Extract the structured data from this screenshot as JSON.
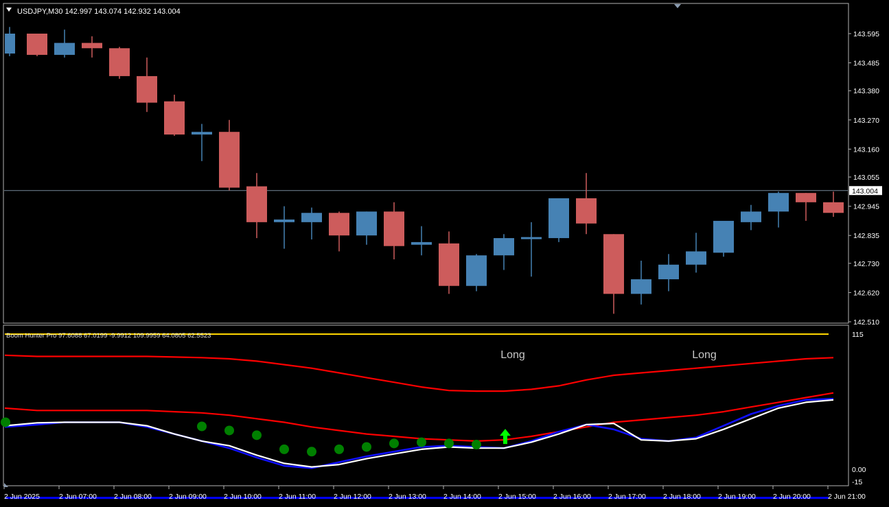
{
  "window": {
    "symbol_header": "USDJPY,M30  142.997 143.074 142.932 143.004",
    "collapse_icon": "triangle-down-icon",
    "scroll_marker_icon": "triangle-down-icon"
  },
  "colors": {
    "background": "#000000",
    "frame": "#b4b4b4",
    "bull": "#4682b4",
    "bear": "#cd5c5c",
    "price_line": "#778899",
    "axis_text": "#ffffff",
    "level_115": "#ffd700",
    "level_0": "#0000ff",
    "red_bands": "#ff0000",
    "blue_line": "#1010ff",
    "white_line": "#ffffff",
    "dots": "#008000",
    "signal_arrow": "#00ff00",
    "long_text": "#c8c8c8"
  },
  "current_price": {
    "value": 143.004,
    "label": "143.004"
  },
  "price_axis_labels": [
    "143.595",
    "143.485",
    "143.380",
    "143.270",
    "143.160",
    "143.055",
    "142.945",
    "142.835",
    "142.730",
    "142.620",
    "142.510"
  ],
  "indicator": {
    "name_label": "Boom Hunter Pro 97.6088 67.0199 -9.9912 109.9959 64.0805 62.5523",
    "axis_labels": {
      "top": "115",
      "zero": "0.00",
      "neg": "-15"
    },
    "signals": [
      {
        "index": 18,
        "text": "Long"
      },
      {
        "index": 25,
        "text": "Long"
      }
    ],
    "arrow_index": 18
  },
  "time_axis": [
    "2 Jun 2025",
    "2 Jun 07:00",
    "2 Jun 08:00",
    "2 Jun 09:00",
    "2 Jun 10:00",
    "2 Jun 11:00",
    "2 Jun 12:00",
    "2 Jun 13:00",
    "2 Jun 14:00",
    "2 Jun 15:00",
    "2 Jun 16:00",
    "2 Jun 17:00",
    "2 Jun 18:00",
    "2 Jun 19:00",
    "2 Jun 20:00",
    "2 Jun 21:00"
  ],
  "chart_data": {
    "type": "candlestick",
    "ylim": [
      142.49,
      143.68
    ],
    "candles": [
      {
        "o": 143.52,
        "h": 143.62,
        "l": 143.51,
        "c": 143.595
      },
      {
        "o": 143.595,
        "h": 143.595,
        "l": 143.51,
        "c": 143.515
      },
      {
        "o": 143.515,
        "h": 143.61,
        "l": 143.505,
        "c": 143.56
      },
      {
        "o": 143.56,
        "h": 143.585,
        "l": 143.505,
        "c": 143.54
      },
      {
        "o": 143.54,
        "h": 143.545,
        "l": 143.425,
        "c": 143.435
      },
      {
        "o": 143.435,
        "h": 143.505,
        "l": 143.3,
        "c": 143.335
      },
      {
        "o": 143.34,
        "h": 143.365,
        "l": 143.21,
        "c": 143.215
      },
      {
        "o": 143.215,
        "h": 143.255,
        "l": 143.115,
        "c": 143.225
      },
      {
        "o": 143.225,
        "h": 143.27,
        "l": 143.005,
        "c": 143.015
      },
      {
        "o": 143.02,
        "h": 143.07,
        "l": 142.825,
        "c": 142.885
      },
      {
        "o": 142.885,
        "h": 142.945,
        "l": 142.785,
        "c": 142.895
      },
      {
        "o": 142.885,
        "h": 142.94,
        "l": 142.82,
        "c": 142.92
      },
      {
        "o": 142.92,
        "h": 142.925,
        "l": 142.775,
        "c": 142.835
      },
      {
        "o": 142.835,
        "h": 142.925,
        "l": 142.8,
        "c": 142.925
      },
      {
        "o": 142.925,
        "h": 142.96,
        "l": 142.745,
        "c": 142.795
      },
      {
        "o": 142.8,
        "h": 142.87,
        "l": 142.76,
        "c": 142.81
      },
      {
        "o": 142.805,
        "h": 142.85,
        "l": 142.615,
        "c": 142.645
      },
      {
        "o": 142.645,
        "h": 142.765,
        "l": 142.625,
        "c": 142.76
      },
      {
        "o": 142.76,
        "h": 142.84,
        "l": 142.705,
        "c": 142.825
      },
      {
        "o": 142.82,
        "h": 142.885,
        "l": 142.68,
        "c": 142.825
      },
      {
        "o": 142.825,
        "h": 142.975,
        "l": 142.81,
        "c": 142.975
      },
      {
        "o": 142.975,
        "h": 143.07,
        "l": 142.84,
        "c": 142.88
      },
      {
        "o": 142.84,
        "h": 142.84,
        "l": 142.54,
        "c": 142.615
      },
      {
        "o": 142.615,
        "h": 142.74,
        "l": 142.575,
        "c": 142.67
      },
      {
        "o": 142.67,
        "h": 142.765,
        "l": 142.625,
        "c": 142.725
      },
      {
        "o": 142.725,
        "h": 142.845,
        "l": 142.695,
        "c": 142.775
      },
      {
        "o": 142.77,
        "h": 142.885,
        "l": 142.755,
        "c": 142.89
      },
      {
        "o": 142.885,
        "h": 142.95,
        "l": 142.855,
        "c": 142.925
      },
      {
        "o": 142.925,
        "h": 143.0,
        "l": 142.865,
        "c": 142.995
      },
      {
        "o": 142.995,
        "h": 142.995,
        "l": 142.89,
        "c": 142.96
      },
      {
        "o": 142.96,
        "h": 143.0,
        "l": 142.905,
        "c": 142.92
      }
    ],
    "indicator": {
      "ylim": [
        -17,
        118
      ],
      "level_top": 115,
      "level_zero": 0,
      "upper_red": [
        97,
        96,
        96,
        96,
        96,
        96,
        95.5,
        95,
        94,
        92,
        89,
        86,
        82,
        78,
        74,
        70,
        67,
        66.5,
        66.5,
        68,
        71,
        76,
        80,
        82,
        84,
        86,
        88,
        90,
        92,
        94,
        95
      ],
      "lower_red": [
        52,
        50,
        50,
        50,
        50,
        50,
        49,
        48,
        46,
        43,
        40,
        36,
        33,
        30,
        28,
        26,
        25,
        24,
        25,
        28,
        32,
        36,
        40,
        42,
        44,
        46,
        49,
        53,
        57,
        61,
        65
      ],
      "blue_line": [
        36,
        38,
        40,
        40,
        40,
        36,
        30,
        24,
        18,
        10,
        3,
        1,
        6,
        11,
        15,
        19,
        20,
        19,
        18,
        24,
        32,
        38,
        34,
        26,
        24,
        27,
        37,
        47,
        54,
        59,
        60
      ],
      "white_line": [
        37,
        39.5,
        40,
        40,
        40,
        37,
        30,
        24,
        20,
        12,
        5,
        2,
        4,
        9,
        13,
        17,
        19,
        18,
        18,
        23,
        30,
        38,
        39,
        25,
        24,
        26,
        34,
        43,
        52,
        57,
        59
      ],
      "dots": [
        40,
        null,
        null,
        null,
        null,
        null,
        null,
        36.5,
        33,
        29,
        17,
        15,
        17,
        19,
        22,
        23,
        22,
        21,
        null,
        null,
        null,
        null,
        null,
        null,
        null,
        null,
        null,
        null,
        null,
        null,
        null
      ]
    }
  }
}
